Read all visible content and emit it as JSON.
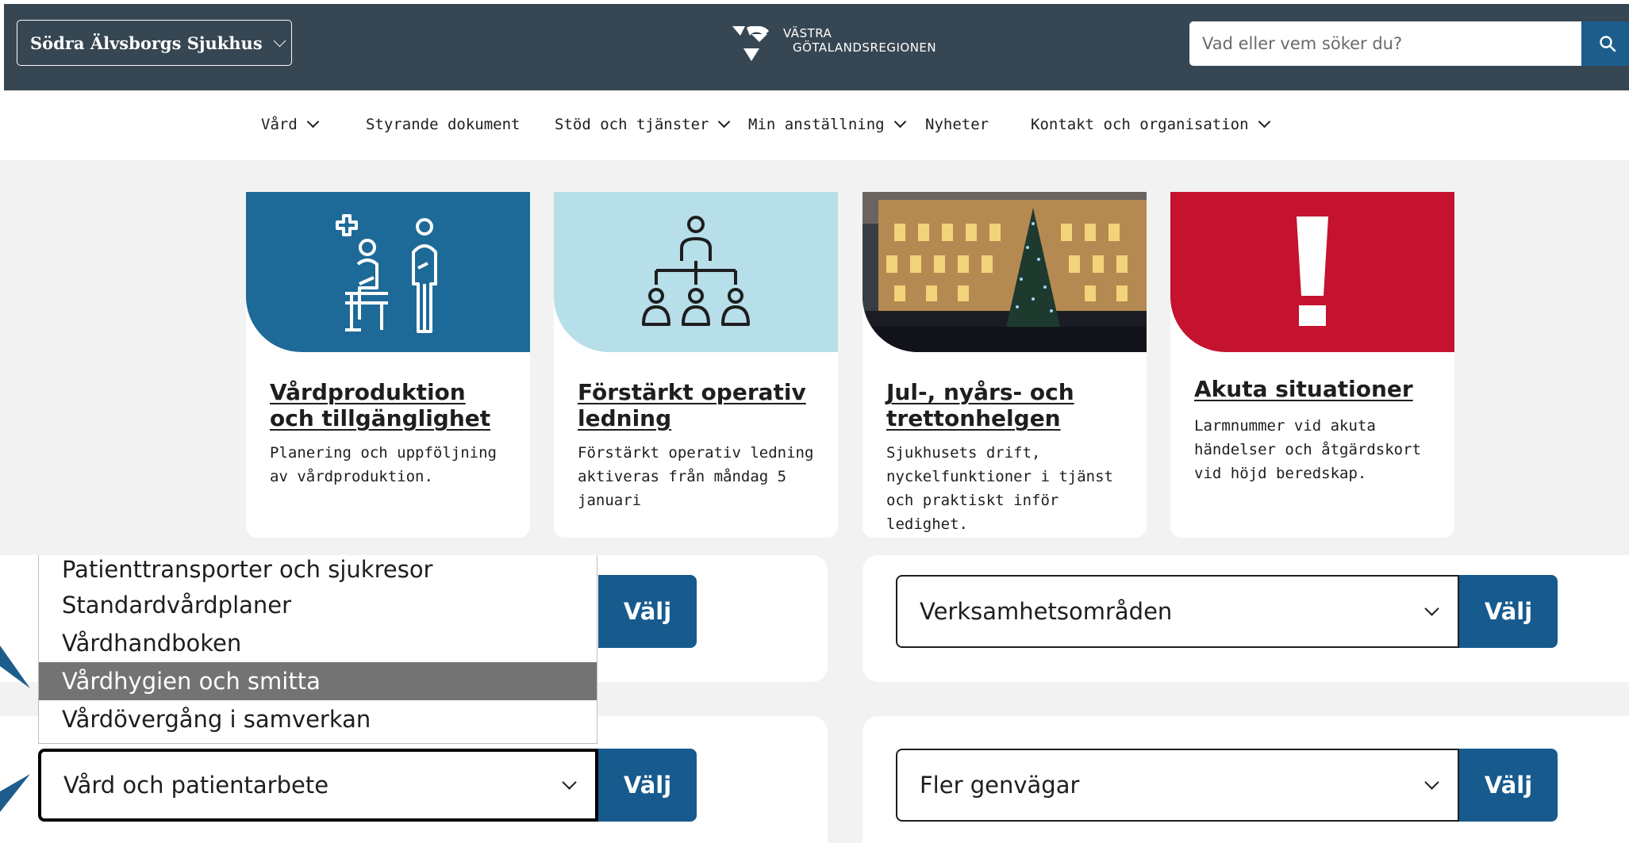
{
  "header": {
    "site_selector": "Södra Älvsborgs Sjukhus",
    "logo_line1": "VÄSTRA",
    "logo_line2": "GÖTALANDSREGIONEN",
    "search_placeholder": "Vad eller vem söker du?",
    "search_icon": "search-icon"
  },
  "nav": {
    "items": [
      {
        "label": "Vård",
        "has_dropdown": true
      },
      {
        "label": "Styrande dokument",
        "has_dropdown": false
      },
      {
        "label": "Stöd och tjänster",
        "has_dropdown": true
      },
      {
        "label": "Min anställning",
        "has_dropdown": true
      },
      {
        "label": "Nyheter",
        "has_dropdown": false
      },
      {
        "label": "Kontakt och organisation",
        "has_dropdown": true
      }
    ]
  },
  "cards": [
    {
      "title": "Vårdproduktion och tillgänglighet",
      "desc": "Planering och uppföljning av vårdproduktion.",
      "image": "care-staff-illustration",
      "bg": "#1d6a98"
    },
    {
      "title": "Förstärkt operativ ledning",
      "desc": "Förstärkt operativ ledning aktiveras från måndag 5 januari",
      "image": "org-chart-illustration",
      "bg": "#b6dfe9"
    },
    {
      "title": "Jul-, nyårs- och trettonhelgen",
      "desc": "Sjukhusets drift, nyckelfunktioner i tjänst och praktiskt inför ledighet.",
      "image": "hospital-christmas-photo",
      "bg": "#2a2a33"
    },
    {
      "title": "Akuta situationer",
      "desc": "Larmnummer vid akuta händelser och åtgärdskort vid höjd beredskap.",
      "image": "exclamation-illustration",
      "bg": "#c4122f"
    }
  ],
  "selects": {
    "care_value": "Vård och patientarbete",
    "verksamhet_value": "Verksamhetsområden",
    "genvagar_value": "Fler genvägar",
    "button_label": "Välj"
  },
  "dropdown": {
    "items": [
      "Patienttransporter och sjukresor",
      "Standardvårdplaner",
      "Vårdhandboken",
      "Vårdhygien och smitta",
      "Vårdövergång i samverkan"
    ],
    "highlighted": "Vårdhygien och smitta"
  },
  "colors": {
    "header_bg": "#364652",
    "accent_blue": "#175a8e",
    "alert_red": "#c4122f",
    "highlight_gray": "#737373",
    "annotation_arrow": "#1d5d8c"
  }
}
